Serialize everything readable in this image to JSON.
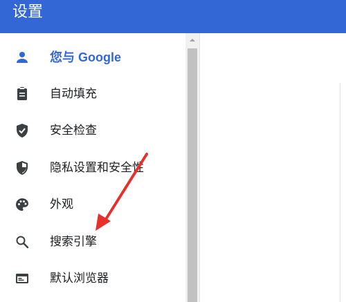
{
  "header": {
    "title": "设置"
  },
  "sidebar": {
    "items": [
      {
        "label": "您与 Google",
        "icon": "person-icon",
        "active": true
      },
      {
        "label": "自动填充",
        "icon": "clipboard-icon",
        "active": false
      },
      {
        "label": "安全检查",
        "icon": "shield-check-icon",
        "active": false
      },
      {
        "label": "隐私设置和安全性",
        "icon": "shield-half-icon",
        "active": false
      },
      {
        "label": "外观",
        "icon": "palette-icon",
        "active": false
      },
      {
        "label": "搜索引擎",
        "icon": "search-icon",
        "active": false
      },
      {
        "label": "默认浏览器",
        "icon": "browser-window-icon",
        "active": false
      }
    ]
  },
  "colors": {
    "header_bg": "#3367d6",
    "active_text": "#3367d6",
    "icon": "#3c4043",
    "annotation_arrow": "#e8302a"
  }
}
